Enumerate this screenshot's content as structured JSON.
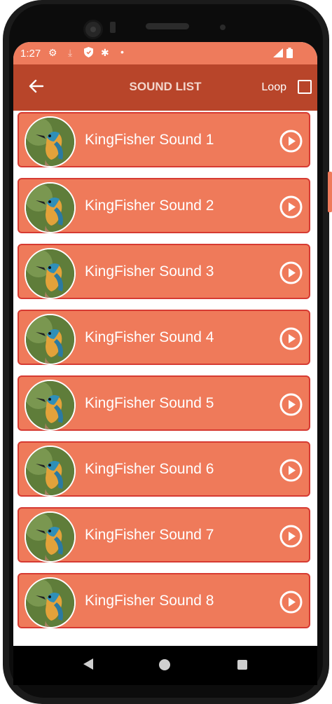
{
  "status_bar": {
    "time": "1:27",
    "icons": [
      "settings-icon",
      "download-icon",
      "shield-icon",
      "bug-icon",
      "dot-icon",
      "signal-icon",
      "battery-icon"
    ]
  },
  "app_bar": {
    "back_icon": "arrow-left-icon",
    "title": "SOUND LIST",
    "loop_label": "Loop",
    "loop_checked": false
  },
  "colors": {
    "status_bar": "#ee7b5c",
    "app_bar": "#b8452a",
    "item_background": "#ef7a5a",
    "item_border": "#d63a32",
    "title_text": "#f3d6cc"
  },
  "sounds": [
    {
      "label": "KingFisher Sound 1",
      "icon": "play-circle-icon"
    },
    {
      "label": "KingFisher Sound 2",
      "icon": "play-circle-icon"
    },
    {
      "label": "KingFisher Sound 3",
      "icon": "play-circle-icon"
    },
    {
      "label": "KingFisher Sound 4",
      "icon": "play-circle-icon"
    },
    {
      "label": "KingFisher Sound 5",
      "icon": "play-circle-icon"
    },
    {
      "label": "KingFisher Sound 6",
      "icon": "play-circle-icon"
    },
    {
      "label": "KingFisher Sound 7",
      "icon": "play-circle-icon"
    },
    {
      "label": "KingFisher Sound 8",
      "icon": "play-circle-icon"
    }
  ],
  "nav_bar": {
    "icons": [
      "back-triangle-icon",
      "home-circle-icon",
      "recents-square-icon"
    ]
  }
}
